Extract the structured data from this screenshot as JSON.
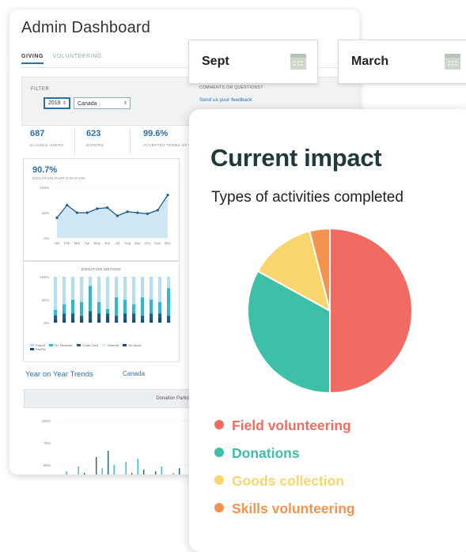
{
  "dashboard": {
    "title": "Admin Dashboard",
    "tabs": [
      "GIVING",
      "VOLUNTEERING"
    ],
    "filter": {
      "label": "FILTER",
      "year": "2019",
      "country": "Canada"
    },
    "stats": [
      {
        "value": "687",
        "label": "ELIGIBLE USERS"
      },
      {
        "value": "623",
        "label": "DONORS"
      },
      {
        "value": "99.6%",
        "label": "ACCEPTED TERMS OF C"
      }
    ],
    "participation": {
      "value": "90.7%",
      "label": "DONATION PARTICIPATION",
      "y_ticks": [
        "100%",
        "50%",
        "0%"
      ],
      "months": [
        "Jan",
        "Feb",
        "Mar",
        "Apr",
        "May",
        "Jun",
        "Jul",
        "Aug",
        "Sep",
        "Oct",
        "Nov",
        "Dec"
      ],
      "values": [
        40,
        65,
        50,
        50,
        58,
        60,
        44,
        52,
        50,
        48,
        55,
        85
      ]
    },
    "methods": {
      "title": "DONATION METHOD",
      "y_ticks": [
        "100%",
        "50%",
        "0%"
      ],
      "legend": [
        "Payroll",
        "No Rewards",
        "Credit Card",
        "Deferral",
        "No funds",
        "PayPal"
      ]
    },
    "yoy": {
      "title": "Year on Year Trends",
      "country": "Canada"
    },
    "trend": {
      "title": "Donation Participation (monthly)",
      "y_ticks": [
        "100%",
        "75%",
        "50%"
      ]
    }
  },
  "month_cards": [
    "Sept",
    "March"
  ],
  "feedback": {
    "question": "COMMENTS OR QUESTIONS?",
    "link": "Send us your feedback"
  },
  "impact": {
    "title": "Current impact",
    "subtitle": "Types of activities completed"
  },
  "chart_data": {
    "type": "pie",
    "series": [
      {
        "name": "Field volunteering",
        "value": 50,
        "color": "#f26b63"
      },
      {
        "name": "Donations",
        "value": 33,
        "color": "#3dbfa8"
      },
      {
        "name": "Goods collection",
        "value": 13,
        "color": "#f8d66d"
      },
      {
        "name": "Skills volunteering",
        "value": 4,
        "color": "#f4934e"
      }
    ]
  }
}
